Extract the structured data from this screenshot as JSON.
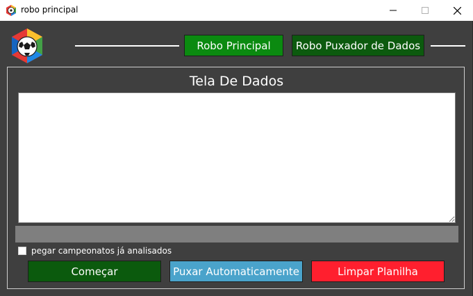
{
  "window": {
    "title": "robo principal",
    "minimize_glyph": "—",
    "maximize_glyph": "☐",
    "close_glyph": "✕"
  },
  "nav": {
    "primary_label": "Robo Principal",
    "secondary_label": "Robo Puxador de Dados"
  },
  "panel": {
    "title": "Tela De Dados",
    "data_text": "",
    "progress_percent": 0
  },
  "options": {
    "checkbox_label": "pegar campeonatos já analisados",
    "checkbox_checked": false
  },
  "actions": {
    "start_label": "Começar",
    "auto_label": "Puxar Automaticamente",
    "clear_label": "Limpar Planilha"
  },
  "colors": {
    "background": "#3f3f3f",
    "nav_primary": "#0b8a10",
    "nav_secondary": "#0c5a0e",
    "start": "#0b5a0d",
    "auto": "#4aa3cb",
    "clear": "#ff1f2e"
  },
  "icons": {
    "app": "soccer-ball-icon",
    "logo": "soccer-ball-hexagon-logo"
  }
}
